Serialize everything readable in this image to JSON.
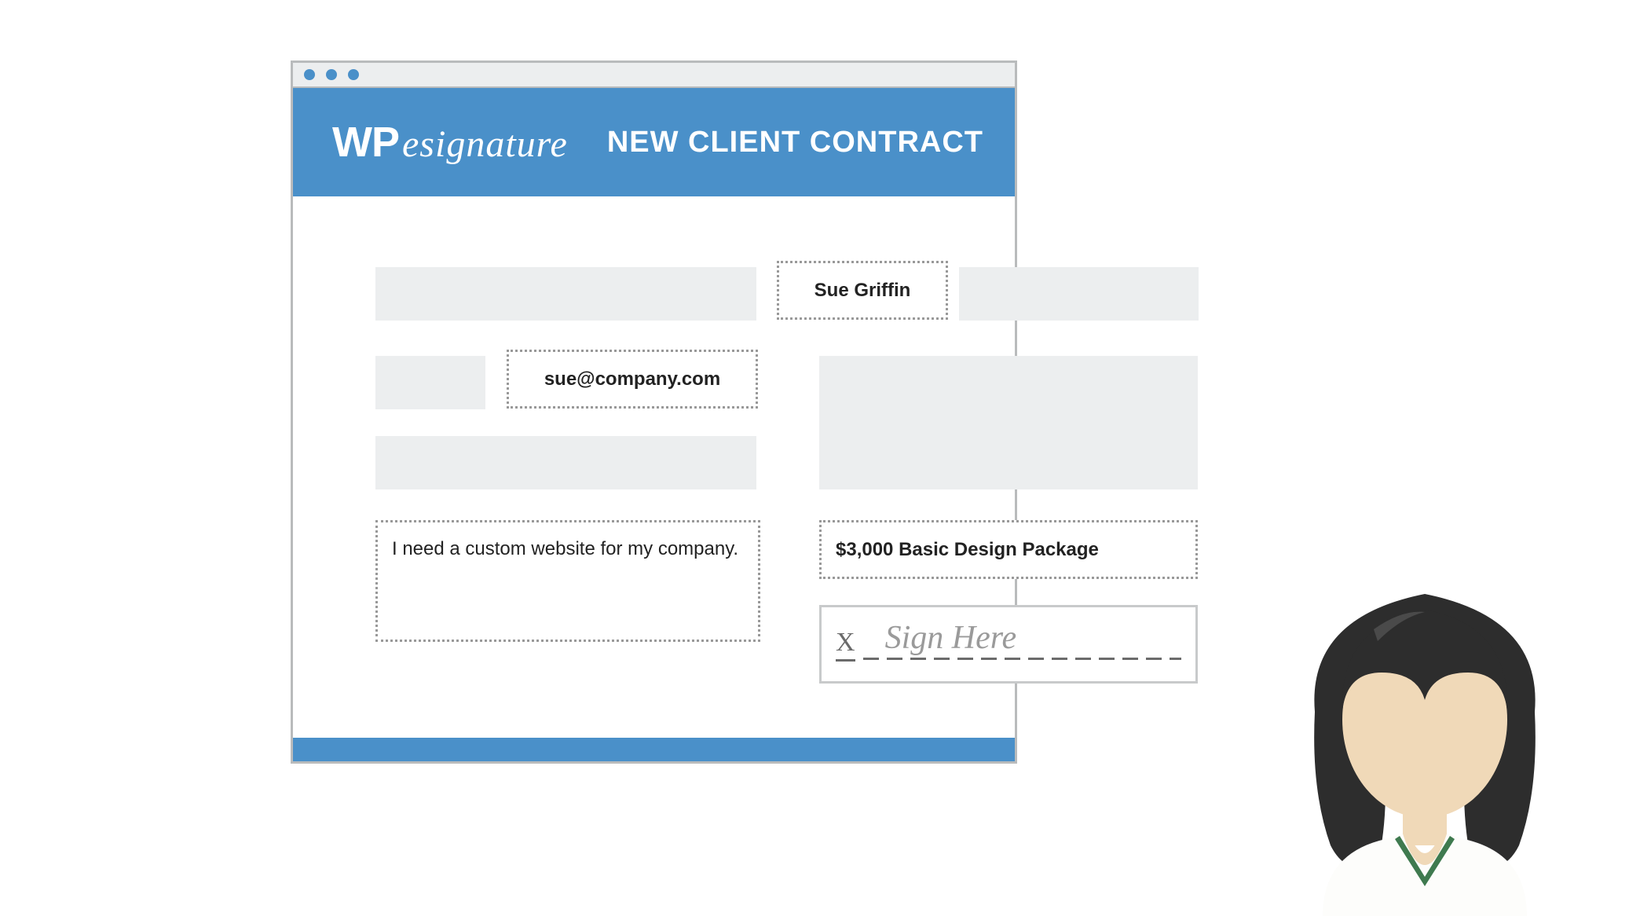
{
  "logo": {
    "prefix": "WP",
    "script": "esignature"
  },
  "header": {
    "title": "NEW CLIENT CONTRACT"
  },
  "fields": {
    "name": "Sue Griffin",
    "email": "sue@company.com",
    "description": "I need a custom website for my company.",
    "package": "$3,000 Basic Design Package"
  },
  "signature": {
    "mark": "X",
    "placeholder": "Sign Here"
  }
}
